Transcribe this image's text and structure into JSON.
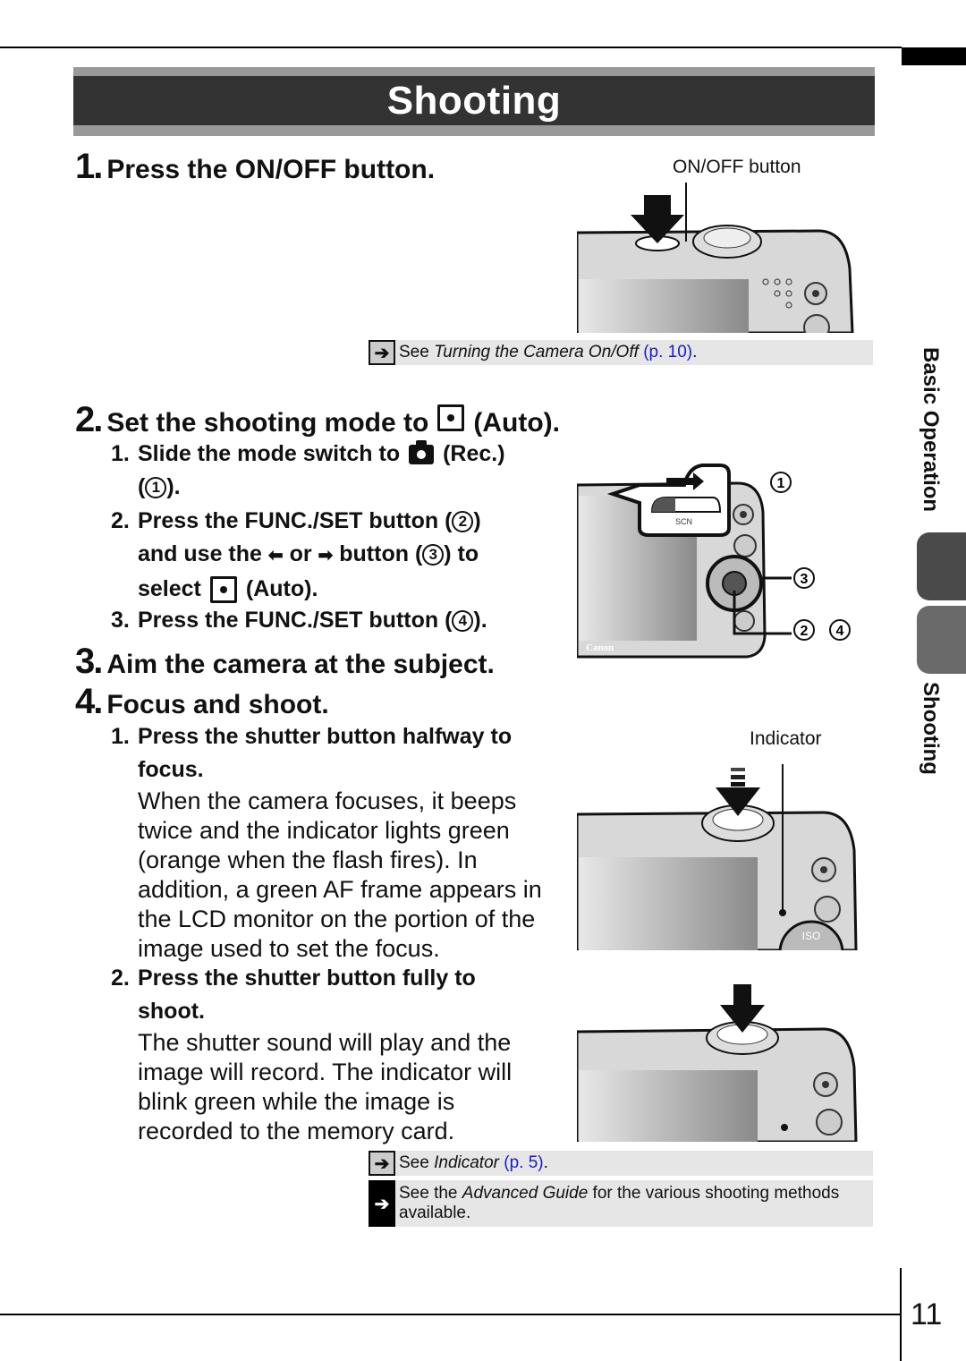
{
  "header": {
    "title": "Shooting"
  },
  "side_nav": {
    "section": "Basic Operation",
    "current": "Shooting",
    "tab_colors": [
      "#4a4a4a",
      "#6a6a6a"
    ]
  },
  "steps": [
    {
      "num": "1.",
      "title": "Press the ON/OFF button.",
      "figure": {
        "label": "ON/OFF button"
      },
      "ref": {
        "prefix": "See ",
        "italic": "Turning the Camera On/Off",
        "link": "(p. 10)",
        "suffix": "."
      }
    },
    {
      "num": "2.",
      "title_pre": "Set the shooting mode to",
      "title_icon": "auto-mode-icon",
      "title_post": "(Auto).",
      "substeps": [
        {
          "num": "1.",
          "pre": "Slide the mode switch to",
          "icon": "camera-rec-icon",
          "post": "(Rec.)",
          "line2_open": "(",
          "marker": "1",
          "line2_close": ")."
        },
        {
          "num": "2.",
          "line1_pre": "Press the FUNC./SET button (",
          "marker1": "2",
          "line1_post": ")",
          "line2_a": "and use the",
          "left_arrow": "⬅",
          "line2_or": "or",
          "right_arrow": "➡",
          "line2_b": "button (",
          "marker2": "3",
          "line2_c": ") to",
          "line3_pre": "select",
          "line3_post": "(Auto)."
        },
        {
          "num": "3.",
          "pre": "Press the FUNC./SET button (",
          "marker": "4",
          "post": ")."
        }
      ],
      "figure": {
        "markers": [
          "1",
          "3",
          "2",
          "4"
        ],
        "mode_labels": "SCN",
        "brand": "Canon"
      }
    },
    {
      "num": "3.",
      "title": "Aim the camera at the subject."
    },
    {
      "num": "4.",
      "title": "Focus and shoot.",
      "substeps": [
        {
          "num": "1.",
          "title": "Press the shutter button halfway to focus.",
          "title_l1": "Press the shutter button halfway to",
          "title_l2": "focus.",
          "body": [
            "When the camera focuses, it beeps",
            "twice and the indicator lights green",
            "(orange when the flash fires). In",
            "addition, a green AF frame appears in",
            "the LCD monitor on the portion of the",
            "image used to set the focus."
          ]
        },
        {
          "num": "2.",
          "title_l1": "Press the shutter button fully to",
          "title_l2": "shoot.",
          "body": [
            "The shutter sound will play and the",
            "image will record. The indicator will",
            "blink green while the image is",
            "recorded to the memory card."
          ]
        }
      ],
      "figure": {
        "label": "Indicator",
        "iso_label": "ISO"
      },
      "refs": [
        {
          "prefix": "See ",
          "italic": "Indicator",
          "link": "(p. 5)",
          "suffix": "."
        },
        {
          "prefix": "See the ",
          "italic": "Advanced Guide",
          "suffix": " for the various shooting methods",
          "line2": "available."
        }
      ]
    }
  ],
  "footer": {
    "page_number": "11"
  },
  "colors": {
    "banner_dark": "#333333",
    "banner_band": "#999999",
    "ref_bg": "#e6e6e6",
    "link": "#1a1acc"
  }
}
